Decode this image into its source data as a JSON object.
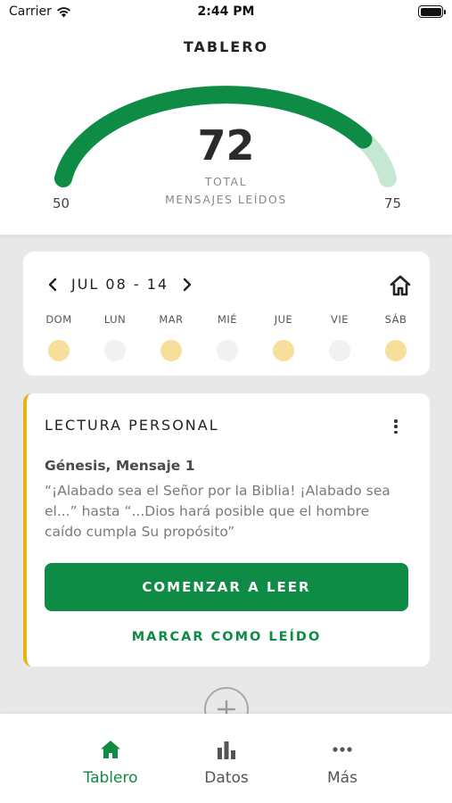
{
  "status_bar": {
    "carrier": "Carrier",
    "time": "2:44 PM"
  },
  "header": {
    "title": "TABLERO",
    "gauge": {
      "value": "72",
      "label_line1": "TOTAL",
      "label_line2": "MENSAJES LEÍDOS",
      "min": "50",
      "max": "75",
      "progress_fraction": 0.88,
      "color_filled": "#0e8b44",
      "color_track": "#c6e8d3"
    }
  },
  "week": {
    "label": "JUL 08 - 14",
    "prev_icon": "chevron-left-icon",
    "next_icon": "chevron-right-icon",
    "home_icon": "home-icon",
    "days": [
      {
        "name": "DOM",
        "read": true
      },
      {
        "name": "LUN",
        "read": false
      },
      {
        "name": "MAR",
        "read": true
      },
      {
        "name": "MIÉ",
        "read": false
      },
      {
        "name": "JUE",
        "read": true
      },
      {
        "name": "VIE",
        "read": false
      },
      {
        "name": "SÁB",
        "read": true
      }
    ],
    "read_color": "#f7df9b",
    "unread_color": "#f1f1f1"
  },
  "reading": {
    "title": "LECTURA PERSONAL",
    "subtitle": "Génesis, Mensaje 1",
    "excerpt": "“¡Alabado sea el Señor por la Biblia! ¡Alabado sea el...” hasta “...Dios hará posible que el hombre caído cumpla Su propósito”",
    "start_button": "COMENZAR A LEER",
    "mark_read": "MARCAR COMO LEÍDO",
    "accent_color": "#e8b20f"
  },
  "tabs": [
    {
      "label": "Tablero",
      "icon": "home-icon",
      "active": true
    },
    {
      "label": "Datos",
      "icon": "bar-chart-icon",
      "active": false
    },
    {
      "label": "Más",
      "icon": "more-horizontal-icon",
      "active": false
    }
  ],
  "colors": {
    "brand_green": "#0e8b44"
  }
}
